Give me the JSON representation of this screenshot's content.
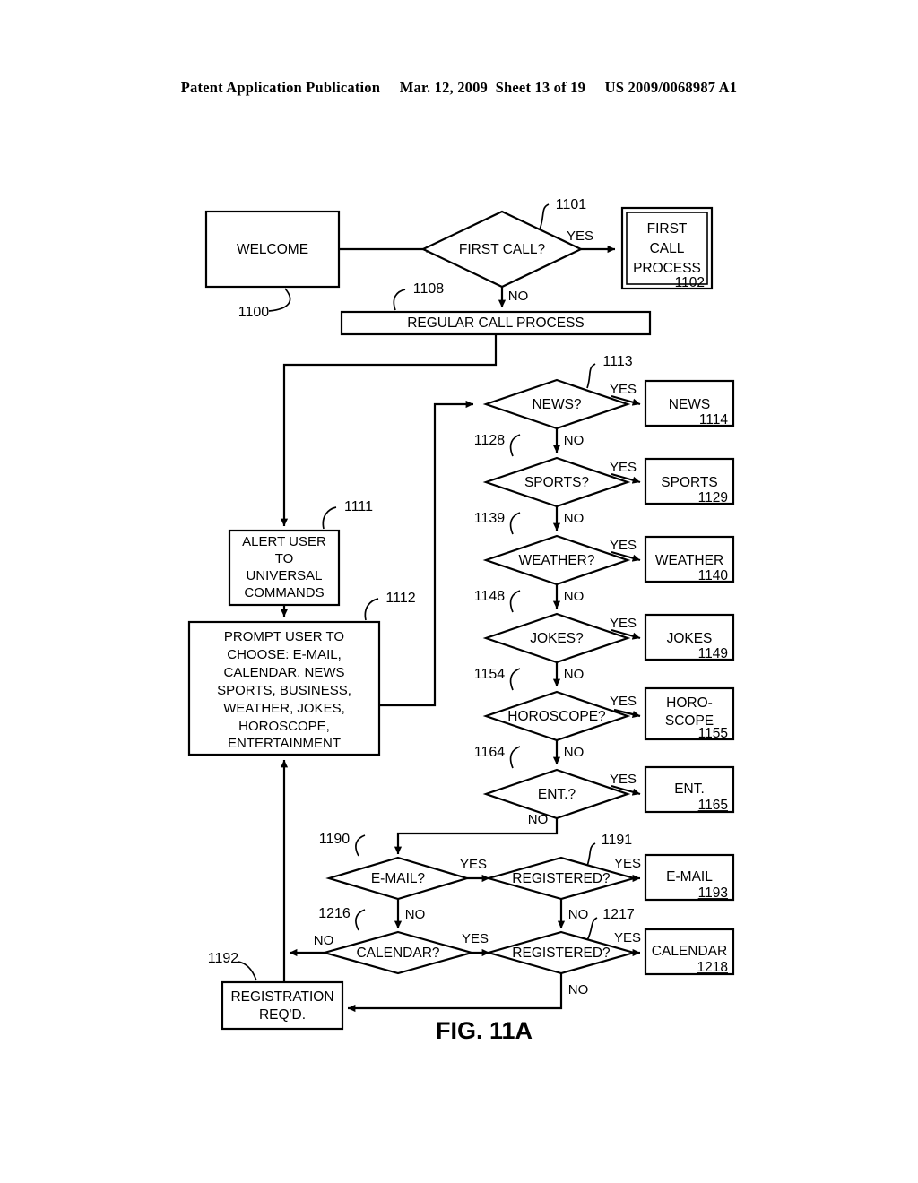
{
  "header": {
    "text": "Patent Application Publication     Mar. 12, 2009  Sheet 13 of 19     US 2009/0068987 A1",
    "publication": "Patent Application Publication",
    "date": "Mar. 12, 2009",
    "sheet": "Sheet 13 of 19",
    "patent_number": "US 2009/0068987 A1"
  },
  "figure": {
    "caption": "FIG. 11A"
  },
  "labels": {
    "yes": "YES",
    "no": "NO"
  },
  "nodes": {
    "welcome": {
      "text": "WELCOME",
      "ref": "1100"
    },
    "first_call_q": {
      "text": "FIRST CALL?",
      "ref": "1101"
    },
    "first_call_proc": {
      "line1": "FIRST",
      "line2": "CALL",
      "line3": "PROCESS",
      "num": "1102"
    },
    "regular_call": {
      "text": "REGULAR CALL PROCESS",
      "ref": "1108"
    },
    "alert_user": {
      "line1": "ALERT USER",
      "line2": "TO",
      "line3": "UNIVERSAL",
      "line4": "COMMANDS",
      "ref": "1111"
    },
    "prompt_user": {
      "line1": "PROMPT USER TO",
      "line2": "CHOOSE: E-MAIL,",
      "line3": "CALENDAR, NEWS",
      "line4": "SPORTS, BUSINESS,",
      "line5": "WEATHER, JOKES,",
      "line6": "HOROSCOPE,",
      "line7": "ENTERTAINMENT",
      "ref": "1112"
    },
    "news_q": {
      "text": "NEWS?",
      "ref": "1113"
    },
    "news_out": {
      "text": "NEWS",
      "num": "1114"
    },
    "sports_q": {
      "text": "SPORTS?",
      "ref": "1128"
    },
    "sports_out": {
      "text": "SPORTS",
      "num": "1129"
    },
    "weather_q": {
      "text": "WEATHER?",
      "ref": "1139"
    },
    "weather_out": {
      "text": "WEATHER",
      "num": "1140"
    },
    "jokes_q": {
      "text": "JOKES?",
      "ref": "1148"
    },
    "jokes_out": {
      "text": "JOKES",
      "num": "1149"
    },
    "horoscope_q": {
      "text": "HOROSCOPE?",
      "ref": "1154"
    },
    "horoscope_out": {
      "line1": "HORO-",
      "line2": "SCOPE",
      "num": "1155"
    },
    "ent_q": {
      "text": "ENT.?",
      "ref": "1164"
    },
    "ent_out": {
      "text": "ENT.",
      "num": "1165"
    },
    "email_q": {
      "text": "E-MAIL?",
      "ref": "1190"
    },
    "registered_q1": {
      "text": "REGISTERED?",
      "ref": "1191"
    },
    "email_out": {
      "text": "E-MAIL",
      "num": "1193"
    },
    "calendar_q": {
      "text": "CALENDAR?",
      "ref": "1216"
    },
    "registered_q2": {
      "text": "REGISTERED?",
      "ref": "1217"
    },
    "calendar_out": {
      "text": "CALENDAR",
      "num": "1218"
    },
    "registration": {
      "line1": "REGISTRATION",
      "line2": "REQ'D.",
      "ref": "1192"
    }
  }
}
